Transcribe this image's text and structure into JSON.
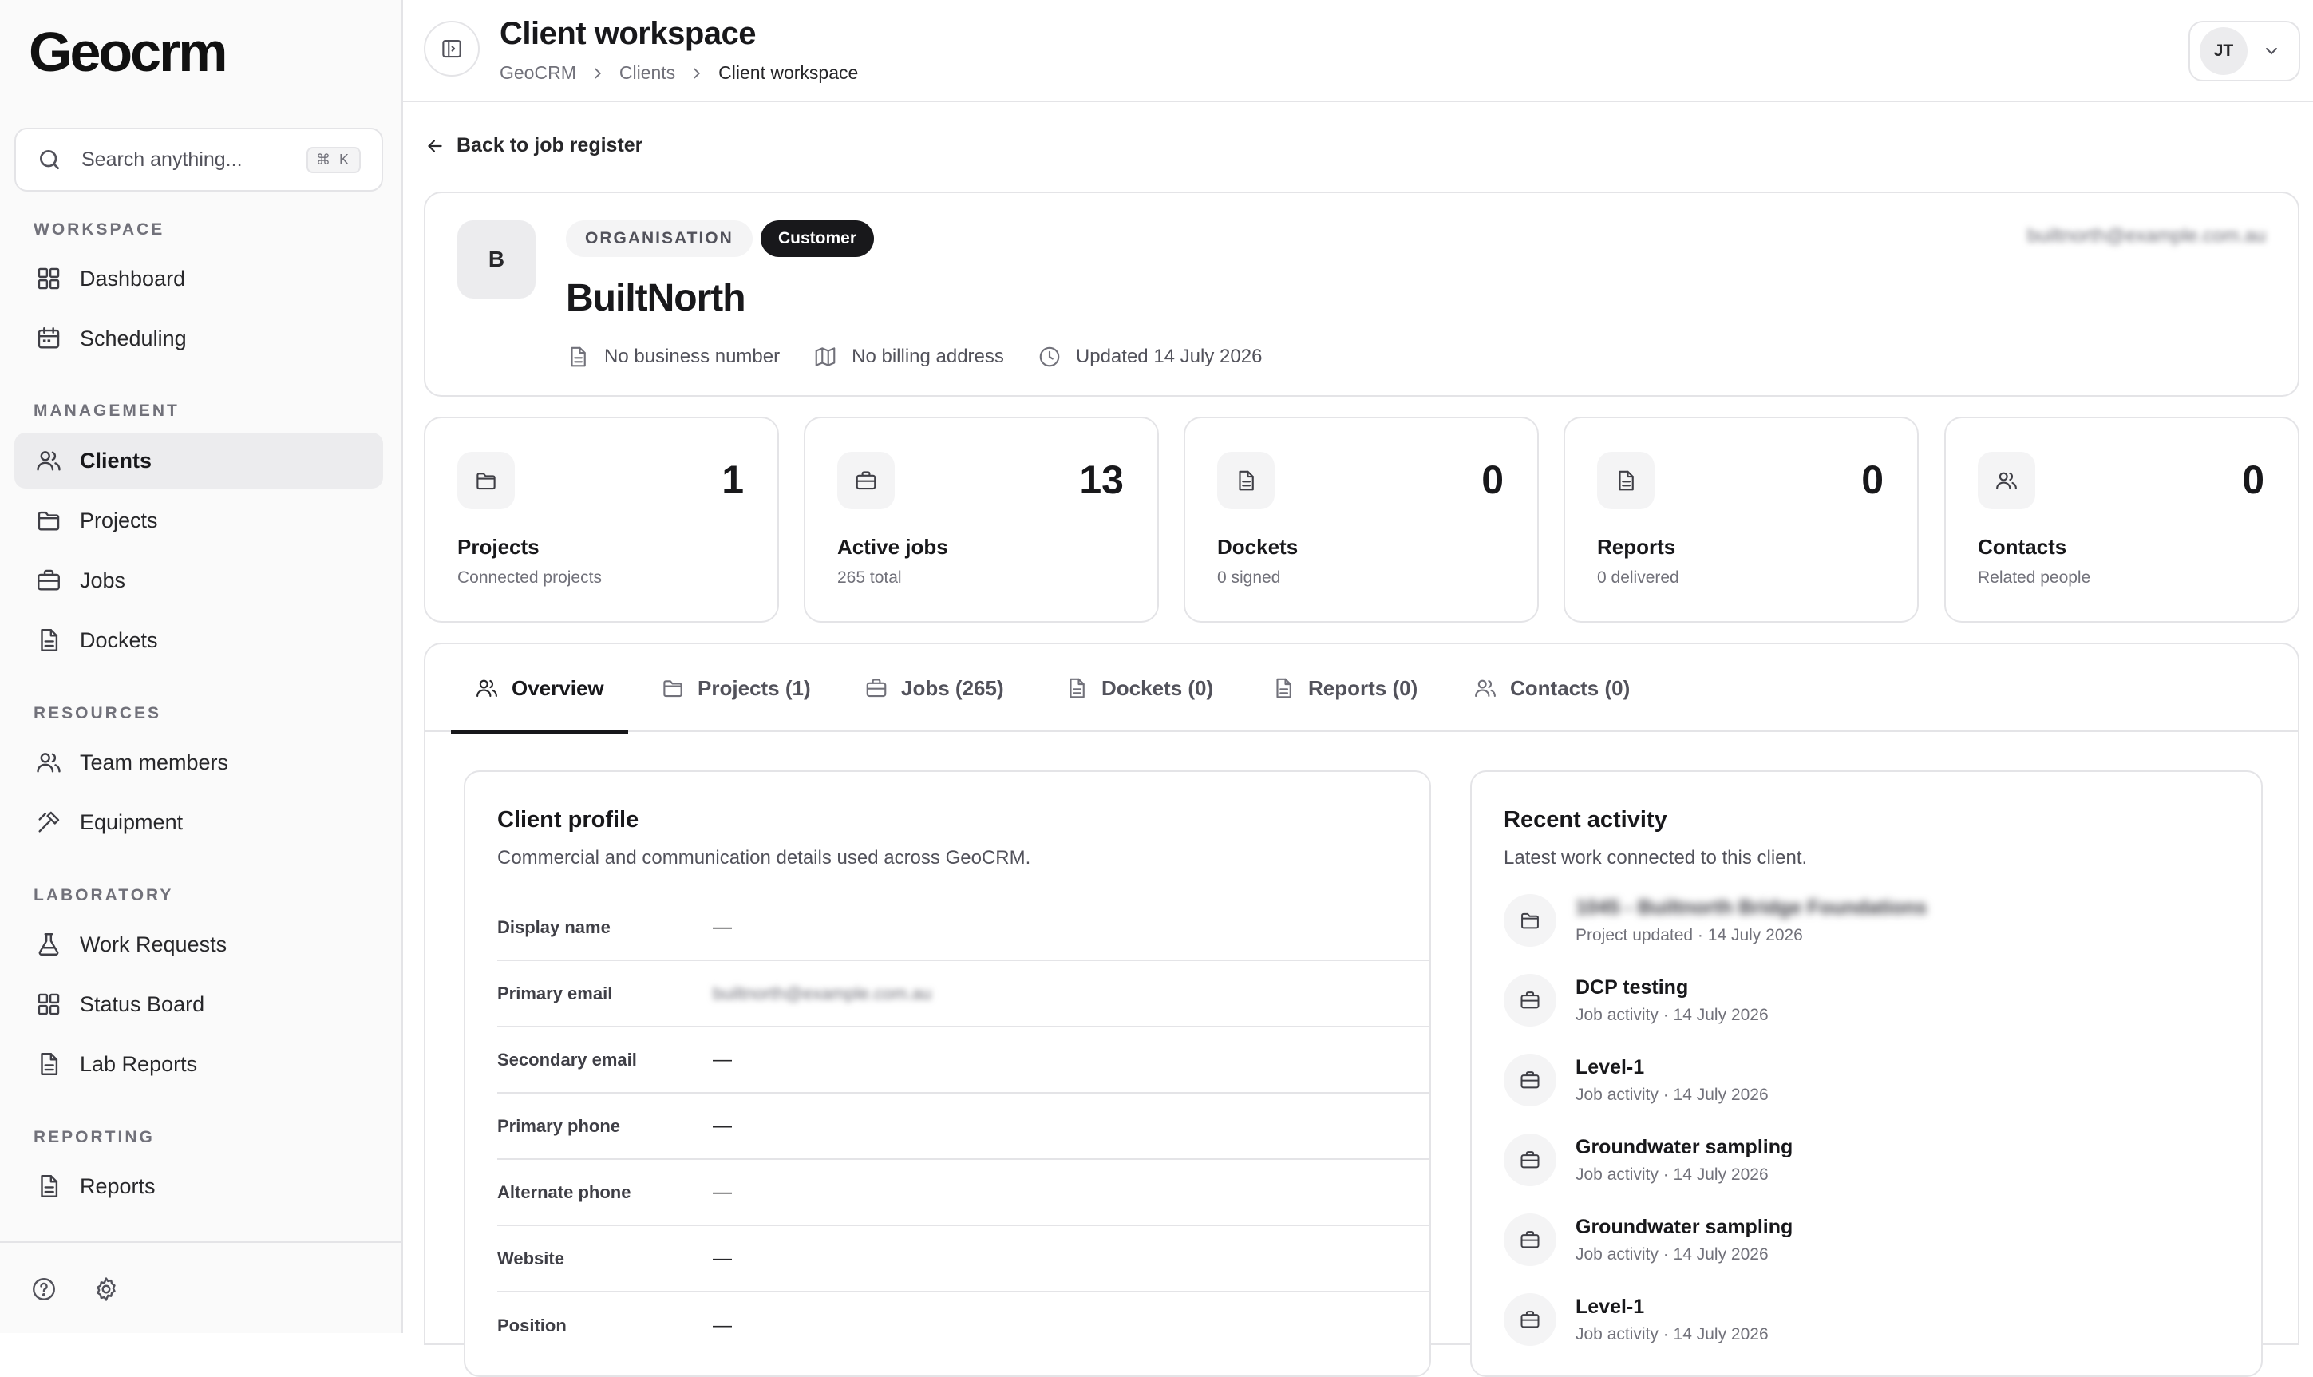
{
  "app": {
    "logo": "Geocrm",
    "search_placeholder": "Search anything...",
    "search_shortcut": "⌘ K"
  },
  "sidebar": {
    "sections": [
      {
        "label": "WORKSPACE",
        "items": [
          {
            "label": "Dashboard",
            "icon": "grid-icon"
          },
          {
            "label": "Scheduling",
            "icon": "calendar-icon"
          }
        ]
      },
      {
        "label": "MANAGEMENT",
        "items": [
          {
            "label": "Clients",
            "icon": "users-icon",
            "active": true
          },
          {
            "label": "Projects",
            "icon": "folder-icon"
          },
          {
            "label": "Jobs",
            "icon": "briefcase-icon"
          },
          {
            "label": "Dockets",
            "icon": "document-icon"
          }
        ]
      },
      {
        "label": "RESOURCES",
        "items": [
          {
            "label": "Team members",
            "icon": "users-icon"
          },
          {
            "label": "Equipment",
            "icon": "tool-icon"
          }
        ]
      },
      {
        "label": "LABORATORY",
        "items": [
          {
            "label": "Work Requests",
            "icon": "flask-icon"
          },
          {
            "label": "Status Board",
            "icon": "grid-icon"
          },
          {
            "label": "Lab Reports",
            "icon": "document-icon"
          }
        ]
      },
      {
        "label": "REPORTING",
        "items": [
          {
            "label": "Reports",
            "icon": "document-icon"
          }
        ]
      }
    ]
  },
  "header": {
    "title": "Client workspace",
    "breadcrumb": [
      "GeoCRM",
      "Clients",
      "Client workspace"
    ],
    "user_initials": "JT"
  },
  "back_link": "Back to job register",
  "client": {
    "initial": "B",
    "type_badge": "ORGANISATION",
    "status_badge": "Customer",
    "name": "BuiltNorth",
    "business_number": "No business number",
    "billing_address": "No billing address",
    "updated": "Updated 14 July 2026",
    "email": "builtnorth@example.com.au"
  },
  "stats": [
    {
      "label": "Projects",
      "value": "1",
      "sub": "Connected projects",
      "icon": "folder-icon"
    },
    {
      "label": "Active jobs",
      "value": "13",
      "sub": "265 total",
      "icon": "briefcase-icon"
    },
    {
      "label": "Dockets",
      "value": "0",
      "sub": "0 signed",
      "icon": "document-icon"
    },
    {
      "label": "Reports",
      "value": "0",
      "sub": "0 delivered",
      "icon": "document-icon"
    },
    {
      "label": "Contacts",
      "value": "0",
      "sub": "Related people",
      "icon": "users-icon"
    }
  ],
  "tabs": [
    {
      "label": "Overview",
      "icon": "users-icon",
      "active": true
    },
    {
      "label": "Projects (1)",
      "icon": "folder-icon"
    },
    {
      "label": "Jobs (265)",
      "icon": "briefcase-icon"
    },
    {
      "label": "Dockets (0)",
      "icon": "document-icon"
    },
    {
      "label": "Reports (0)",
      "icon": "document-icon"
    },
    {
      "label": "Contacts (0)",
      "icon": "users-icon"
    }
  ],
  "profile": {
    "title": "Client profile",
    "subtitle": "Commercial and communication details used across GeoCRM.",
    "fields": [
      {
        "label": "Display name",
        "value": "—"
      },
      {
        "label": "Primary email",
        "value": "builtnorth@example.com.au"
      },
      {
        "label": "Secondary email",
        "value": "—"
      },
      {
        "label": "Primary phone",
        "value": "—"
      },
      {
        "label": "Alternate phone",
        "value": "—"
      },
      {
        "label": "Website",
        "value": "—"
      },
      {
        "label": "Position",
        "value": "—"
      }
    ]
  },
  "activity": {
    "title": "Recent activity",
    "subtitle": "Latest work connected to this client.",
    "items": [
      {
        "title": "1045 - Builtnorth Bridge Foundations",
        "meta": "Project updated · 14 July 2026",
        "icon": "folder-icon",
        "redacted": true
      },
      {
        "title": "DCP testing",
        "meta": "Job activity · 14 July 2026",
        "icon": "briefcase-icon"
      },
      {
        "title": "Level-1",
        "meta": "Job activity · 14 July 2026",
        "icon": "briefcase-icon"
      },
      {
        "title": "Groundwater sampling",
        "meta": "Job activity · 14 July 2026",
        "icon": "briefcase-icon"
      },
      {
        "title": "Groundwater sampling",
        "meta": "Job activity · 14 July 2026",
        "icon": "briefcase-icon"
      },
      {
        "title": "Level-1",
        "meta": "Job activity · 14 July 2026",
        "icon": "briefcase-icon"
      }
    ]
  }
}
